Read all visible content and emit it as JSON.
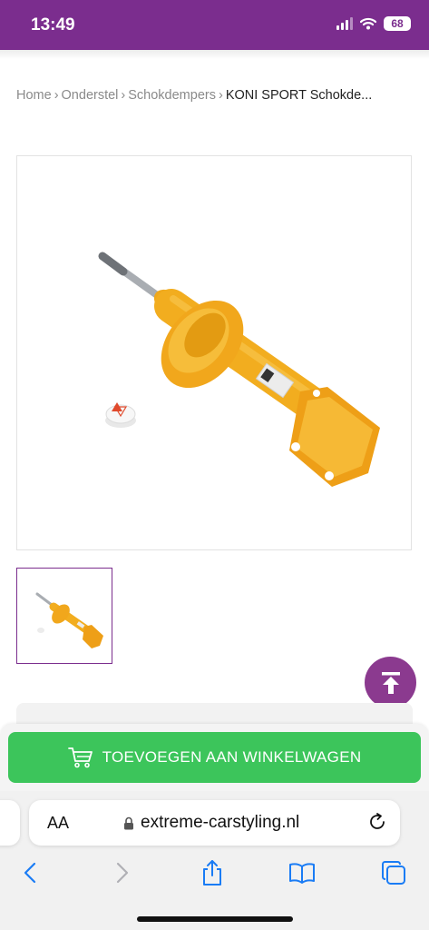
{
  "status_bar": {
    "time": "13:49",
    "battery": "68"
  },
  "colors": {
    "brand": "#7b2d8e",
    "cart_green": "#3cc55b",
    "to_top": "#8b3a8f"
  },
  "breadcrumb": {
    "items": [
      "Home",
      "Onderstel",
      "Schokdempers"
    ],
    "current": "KONI SPORT Schokde...",
    "separator": "›"
  },
  "product": {
    "image_icon": "shock-absorber-image",
    "thumbnail_icon": "shock-absorber-thumbnail"
  },
  "buttons": {
    "cart_label": "TOEVOEGEN AAN WINKELWAGEN",
    "cart_icon": "cart-icon",
    "to_top_icon": "arrow-up-to-top-icon"
  },
  "browser": {
    "text_size_label": "AA",
    "url": "extreme-carstyling.nl",
    "icons": [
      "lock-icon",
      "reload-icon",
      "back-icon",
      "forward-icon",
      "share-icon",
      "bookmarks-icon",
      "tabs-icon"
    ]
  }
}
